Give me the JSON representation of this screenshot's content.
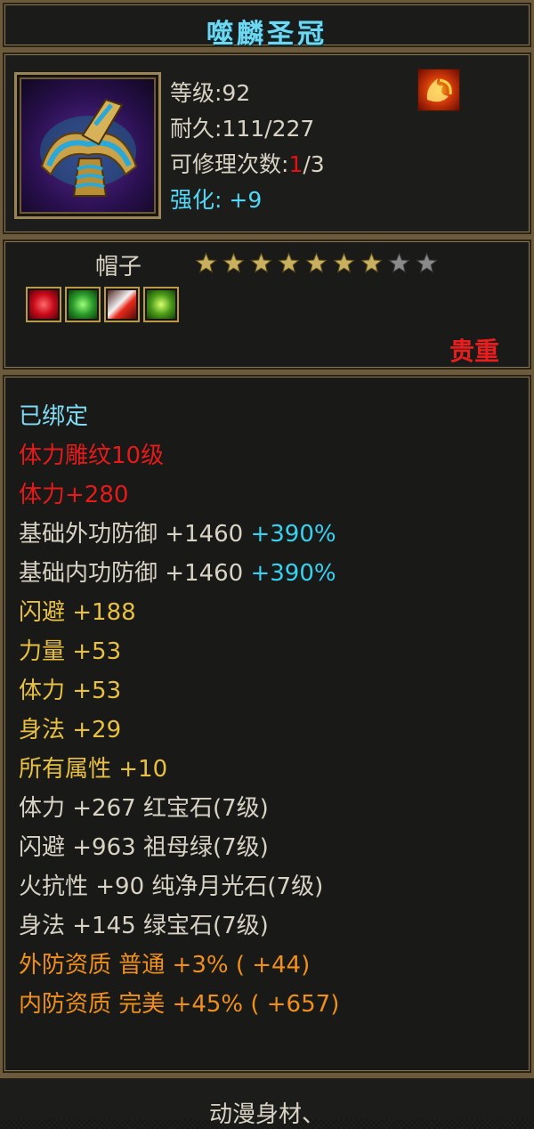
{
  "title": "噬麟圣冠",
  "info": {
    "level": "等级:92",
    "durability": "耐久:111/227",
    "repair_prefix": "可修理次数:",
    "repair_used": "1",
    "repair_suffix": "/3",
    "enhance": "强化: +9",
    "item_icon": "crown-icon",
    "element_icon": "fire-icon"
  },
  "category": {
    "type": "帽子",
    "stars_filled": 7,
    "stars_total": 9,
    "gem_icons": [
      "red-gem-icon",
      "green-gem-icon",
      "moonstone-gem-icon",
      "emerald-gem-icon"
    ],
    "rarity": "贵重"
  },
  "attributes": {
    "bound": "已绑定",
    "engrave": "体力雕纹10级",
    "stamina_bonus": "体力+280",
    "ext_def_label": "基础外功防御  +1460",
    "ext_def_pct": "+390%",
    "int_def_label": "基础内功防御  +1460",
    "int_def_pct": "+390%",
    "dodge": "闪避  +188",
    "strength": "力量  +53",
    "stamina": "体力  +53",
    "agility": "身法  +29",
    "all_attr": "所有属性  +10",
    "gem1": "体力  +267  红宝石(7级)",
    "gem2": "闪避  +963  祖母绿(7级)",
    "gem3": "火抗性  +90  纯净月光石(7级)",
    "gem4": "身法  +145  绿宝石(7级)",
    "quality_ext": "外防资质   普通  +3% ( +44)",
    "quality_int": "内防资质   完美  +45% ( +657)"
  },
  "footer": {
    "text": "动漫身材、"
  },
  "colors": {
    "border": "#6b5a3c",
    "cyan": "#7fdcf4",
    "red": "#e51a1a",
    "yellow": "#e8c040",
    "orange": "#f0901a"
  }
}
